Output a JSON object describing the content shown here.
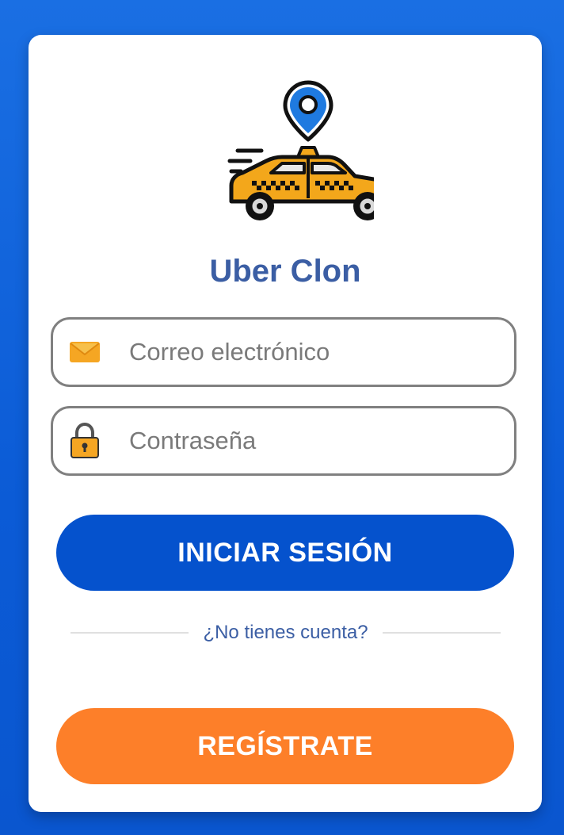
{
  "app": {
    "title": "Uber Clon",
    "logo_icon": "taxi-with-location-pin-icon"
  },
  "form": {
    "email": {
      "placeholder": "Correo electrónico",
      "value": "",
      "icon": "envelope-icon"
    },
    "password": {
      "placeholder": "Contraseña",
      "value": "",
      "icon": "padlock-icon"
    }
  },
  "buttons": {
    "login_label": "INICIAR SESIÓN",
    "register_label": "REGÍSTRATE"
  },
  "divider_text": "¿No tienes cuenta?",
  "colors": {
    "background": "#1a6fe3",
    "title": "#3b5ea4",
    "login_button": "#0552cd",
    "register_button": "#fd7f29",
    "field_border": "#808080"
  }
}
